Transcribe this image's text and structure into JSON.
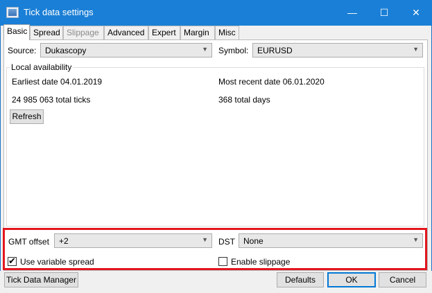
{
  "window": {
    "title": "Tick data settings"
  },
  "title_controls": {
    "minimize": "—",
    "maximize": "☐",
    "close": "✕"
  },
  "tabs": [
    {
      "label": "Basic",
      "state": "active"
    },
    {
      "label": "Spread",
      "state": "normal"
    },
    {
      "label": "Slippage",
      "state": "disabled"
    },
    {
      "label": "Advanced",
      "state": "normal"
    },
    {
      "label": "Expert",
      "state": "normal"
    },
    {
      "label": "Margin",
      "state": "normal"
    },
    {
      "label": "Misc",
      "state": "normal"
    }
  ],
  "source": {
    "label": "Source:",
    "value": "Dukascopy"
  },
  "symbol": {
    "label": "Symbol:",
    "value": "EURUSD"
  },
  "availability": {
    "title": "Local availability",
    "earliest": "Earliest date 04.01.2019",
    "recent": "Most recent date 06.01.2020",
    "ticks": "24 985 063 total ticks",
    "days": "368 total days",
    "refresh": "Refresh"
  },
  "gmt": {
    "label": "GMT offset",
    "value": "+2"
  },
  "dst": {
    "label": "DST",
    "value": "None"
  },
  "variable_spread": {
    "label": "Use variable spread",
    "checked": true
  },
  "enable_slippage": {
    "label": "Enable slippage",
    "checked": false
  },
  "buttons": {
    "tick_manager": "Tick Data Manager",
    "defaults": "Defaults",
    "ok": "OK",
    "cancel": "Cancel"
  },
  "colors": {
    "titlebar": "#1a7fd6",
    "highlight": "#e3161e"
  }
}
